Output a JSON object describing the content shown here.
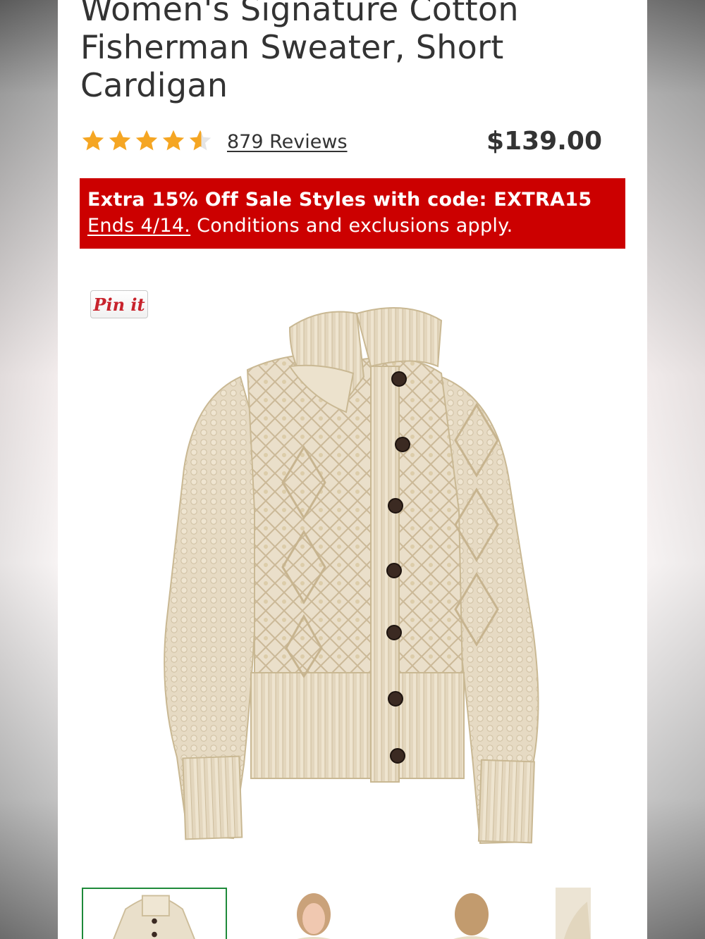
{
  "product": {
    "title": "Women's Signature Cotton Fisherman Sweater, Short Cardigan",
    "rating": 4.5,
    "reviews_label": "879 Reviews",
    "price": "$139.00"
  },
  "promo": {
    "headline": "Extra 15% Off Sale Styles with code: EXTRA15",
    "ends_label": "Ends 4/14.",
    "conditions": "Conditions and exclusions apply."
  },
  "pin_button": {
    "label": "Pin it"
  },
  "colors": {
    "promo_background": "#cc0000",
    "star": "#f5a623",
    "text": "#333333",
    "thumb_active_border": "#1e8a3a"
  },
  "gallery": {
    "thumbnails": [
      {
        "subject": "cardigan-front",
        "active": true
      },
      {
        "subject": "model-front",
        "active": false
      },
      {
        "subject": "model-back",
        "active": false
      },
      {
        "subject": "detail",
        "active": false
      }
    ]
  }
}
